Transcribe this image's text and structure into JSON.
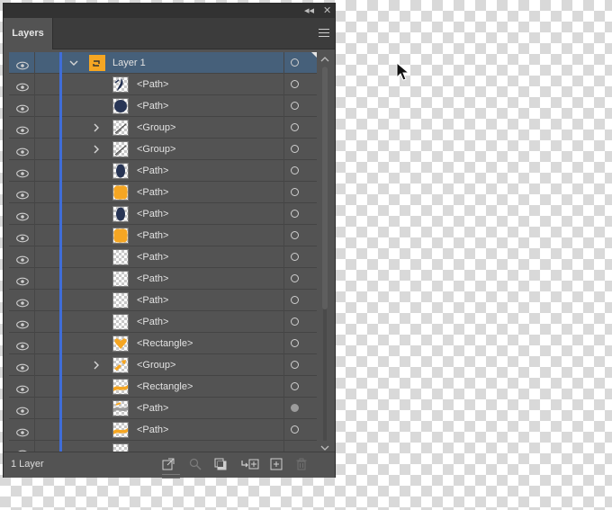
{
  "panel": {
    "collapse_glyph": "◂◂",
    "close_glyph": "✕",
    "tab_label": "Layers",
    "menu_icon": "hamburger-menu-icon"
  },
  "rows": [
    {
      "name": "Layer 1",
      "kind": "layer",
      "expand": "collapse",
      "selected": true,
      "thumb": "layer-icon",
      "target": "empty"
    },
    {
      "name": "<Path>",
      "kind": "path",
      "thumb": "feather-path",
      "target": "empty"
    },
    {
      "name": "<Path>",
      "kind": "path",
      "thumb": "navy-circle",
      "target": "empty"
    },
    {
      "name": "<Group>",
      "kind": "group",
      "expand": "expand",
      "thumb": "line-group",
      "target": "empty"
    },
    {
      "name": "<Group>",
      "kind": "group",
      "expand": "expand",
      "thumb": "line-group",
      "target": "empty"
    },
    {
      "name": "<Path>",
      "kind": "path",
      "thumb": "navy-oval",
      "target": "empty"
    },
    {
      "name": "<Path>",
      "kind": "path",
      "thumb": "orange-rounded",
      "target": "empty"
    },
    {
      "name": "<Path>",
      "kind": "path",
      "thumb": "navy-oval",
      "target": "empty"
    },
    {
      "name": "<Path>",
      "kind": "path",
      "thumb": "orange-rounded",
      "target": "empty"
    },
    {
      "name": "<Path>",
      "kind": "path",
      "thumb": "transparent",
      "target": "empty"
    },
    {
      "name": "<Path>",
      "kind": "path",
      "thumb": "transparent",
      "target": "empty"
    },
    {
      "name": "<Path>",
      "kind": "path",
      "thumb": "transparent",
      "target": "empty"
    },
    {
      "name": "<Path>",
      "kind": "path",
      "thumb": "transparent",
      "target": "empty"
    },
    {
      "name": "<Rectangle>",
      "kind": "rectangle",
      "thumb": "orange-heart",
      "target": "empty"
    },
    {
      "name": "<Group>",
      "kind": "group",
      "expand": "expand",
      "thumb": "orange-bits",
      "target": "empty"
    },
    {
      "name": "<Rectangle>",
      "kind": "rectangle",
      "thumb": "orange-streak",
      "target": "empty"
    },
    {
      "name": "<Path>",
      "kind": "path",
      "thumb": "gray-streak",
      "target": "filled"
    },
    {
      "name": "<Path>",
      "kind": "path",
      "thumb": "orange-streak",
      "target": "empty"
    },
    {
      "name": "",
      "kind": "path",
      "thumb": "partial",
      "target": "none"
    }
  ],
  "footer": {
    "count_label": "1 Layer",
    "buttons": [
      "export-icon",
      "locate-object-icon",
      "clipping-mask-icon",
      "new-sublayer-icon",
      "new-layer-icon",
      "trash-icon"
    ]
  },
  "colors": {
    "panel_bg": "#535353",
    "selected_row": "#46607a",
    "layer_color": "#3f6dd8",
    "orange": "#f5a623",
    "navy": "#283555"
  }
}
